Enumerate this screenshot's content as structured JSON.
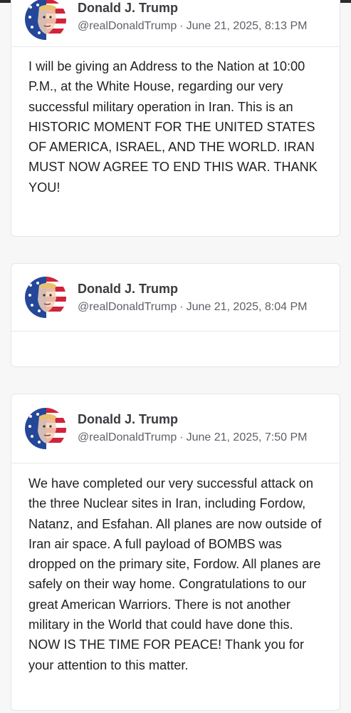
{
  "posts": [
    {
      "author": "Donald J. Trump",
      "handle": "@realDonaldTrump",
      "separator": "·",
      "timestamp": "June 21, 2025, 8:13 PM",
      "text": "I will be giving an Address to the Nation at 10:00 P.M., at the White House, regarding our very successful military operation in Iran. This is an HISTORIC MOMENT FOR THE UNITED STATES OF AMERICA, ISRAEL, AND THE WORLD. IRAN MUST NOW AGREE TO END THIS WAR. THANK YOU!"
    },
    {
      "author": "Donald J. Trump",
      "handle": "@realDonaldTrump",
      "separator": "·",
      "timestamp": "June 21, 2025, 8:04 PM",
      "text": ""
    },
    {
      "author": "Donald J. Trump",
      "handle": "@realDonaldTrump",
      "separator": "·",
      "timestamp": "June 21, 2025, 7:50 PM",
      "text": "We have completed our very successful attack on the three Nuclear sites in Iran, including Fordow, Natanz, and Esfahan. All planes are now outside of Iran air space. A full payload of BOMBS was dropped on the primary site, Fordow. All planes are safely on their way home. Congratulations to our great American Warriors. There is not another military in the World that could have done this. NOW IS THE TIME FOR PEACE! Thank you for your attention to this matter."
    }
  ],
  "colors": {
    "page_background": "#f7f7f8",
    "card_border": "#e3e5e8",
    "author_text": "#3a3c40",
    "meta_text": "#5e6167",
    "body_text": "#1f2022"
  },
  "icons": {
    "avatar": "avatar-flag-portrait-icon"
  }
}
